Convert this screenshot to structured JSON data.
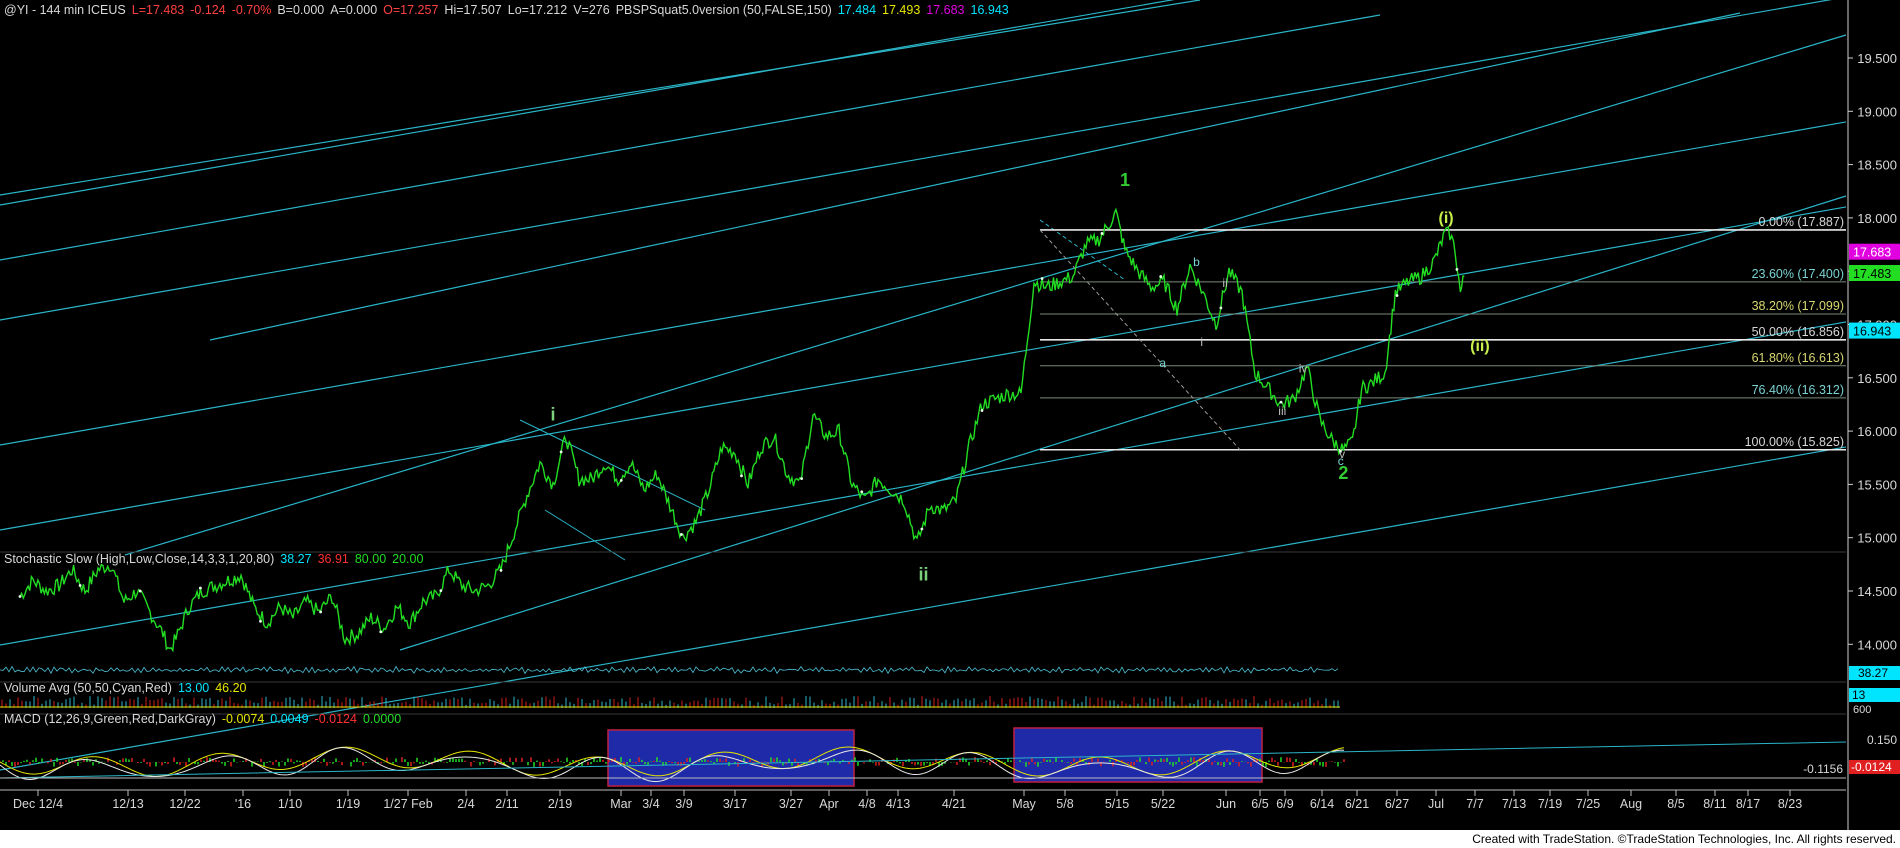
{
  "header": {
    "symbol": "@YI - 144 min  ICEUS",
    "last": "L=17.483",
    "chg": "-0.124",
    "pct": "-0.70%",
    "bid": "B=0.000",
    "ask": "A=0.000",
    "open": "O=17.257",
    "hi": "Hi=17.507",
    "lo": "Lo=17.212",
    "vol": "V=276",
    "study": "PBSPSquat5.0version (50,FALSE,150)",
    "v1": "17.484",
    "v2": "17.493",
    "v3": "17.683",
    "v4": "16.943"
  },
  "colors": {
    "price": "#22dd22",
    "channel": "#2ab5c8",
    "cyan": "#00e5ff",
    "yellow": "#e6e600",
    "magenta": "#e000e0",
    "blue": "#1e2aa8"
  },
  "chart_data": {
    "type": "line",
    "title": "@YI - 144 min ICEUS",
    "ylim": [
      13.75,
      20.0
    ],
    "yticks": [
      14.0,
      14.5,
      15.0,
      15.5,
      16.0,
      16.5,
      17.0,
      17.5,
      18.0,
      18.5,
      19.0,
      19.5
    ],
    "ytick_labels": [
      "14.000",
      "14.500",
      "15.000",
      "15.500",
      "16.000",
      "16.500",
      "17.000",
      "17.500",
      "18.000",
      "18.500",
      "19.000",
      "19.500"
    ],
    "xtick_labels": [
      "Dec 12/4",
      "12/13",
      "12/22",
      "'16",
      "1/10",
      "1/19",
      "1/27 Feb",
      "2/4",
      "2/11",
      "2/19",
      "Mar",
      "3/4",
      "3/9",
      "3/17",
      "3/27",
      "Apr",
      "4/8",
      "4/13",
      "4/21",
      "May",
      "5/8",
      "5/15",
      "5/22",
      "Jun",
      "6/5",
      "6/9",
      "6/14",
      "6/21",
      "6/27",
      "Jul",
      "7/7",
      "7/13",
      "7/19",
      "7/25",
      "Aug",
      "8/5",
      "8/11",
      "8/17",
      "8/23"
    ],
    "price_path": [
      [
        0,
        14.45
      ],
      [
        10,
        14.6
      ],
      [
        20,
        14.5
      ],
      [
        30,
        14.55
      ],
      [
        40,
        14.7
      ],
      [
        50,
        14.5
      ],
      [
        60,
        14.7
      ],
      [
        70,
        14.75
      ],
      [
        80,
        14.4
      ],
      [
        90,
        14.5
      ],
      [
        100,
        14.3
      ],
      [
        110,
        14.1
      ],
      [
        115,
        13.95
      ],
      [
        120,
        14.05
      ],
      [
        130,
        14.35
      ],
      [
        140,
        14.5
      ],
      [
        150,
        14.55
      ],
      [
        160,
        14.6
      ],
      [
        170,
        14.65
      ],
      [
        180,
        14.35
      ],
      [
        190,
        14.2
      ],
      [
        200,
        14.35
      ],
      [
        210,
        14.25
      ],
      [
        220,
        14.4
      ],
      [
        230,
        14.3
      ],
      [
        240,
        14.45
      ],
      [
        250,
        14.05
      ],
      [
        260,
        14.1
      ],
      [
        270,
        14.25
      ],
      [
        280,
        14.15
      ],
      [
        290,
        14.35
      ],
      [
        300,
        14.2
      ],
      [
        310,
        14.4
      ],
      [
        320,
        14.45
      ],
      [
        330,
        14.7
      ],
      [
        340,
        14.55
      ],
      [
        350,
        14.5
      ],
      [
        360,
        14.55
      ],
      [
        370,
        14.7
      ],
      [
        380,
        15.05
      ],
      [
        390,
        15.4
      ],
      [
        400,
        15.7
      ],
      [
        410,
        15.5
      ],
      [
        420,
        15.95
      ],
      [
        430,
        15.55
      ],
      [
        440,
        15.55
      ],
      [
        450,
        15.7
      ],
      [
        460,
        15.55
      ],
      [
        470,
        15.7
      ],
      [
        480,
        15.45
      ],
      [
        490,
        15.6
      ],
      [
        500,
        15.3
      ],
      [
        510,
        15.0
      ],
      [
        520,
        15.15
      ],
      [
        530,
        15.45
      ],
      [
        540,
        15.85
      ],
      [
        550,
        15.8
      ],
      [
        560,
        15.5
      ],
      [
        570,
        15.85
      ],
      [
        580,
        15.95
      ],
      [
        590,
        15.6
      ],
      [
        600,
        15.5
      ],
      [
        610,
        16.15
      ],
      [
        620,
        15.95
      ],
      [
        630,
        16.0
      ],
      [
        640,
        15.5
      ],
      [
        650,
        15.35
      ],
      [
        660,
        15.55
      ],
      [
        670,
        15.45
      ],
      [
        680,
        15.35
      ],
      [
        690,
        14.95
      ],
      [
        700,
        15.3
      ],
      [
        710,
        15.25
      ],
      [
        720,
        15.35
      ],
      [
        730,
        15.85
      ],
      [
        740,
        16.25
      ],
      [
        750,
        16.3
      ],
      [
        760,
        16.35
      ],
      [
        770,
        16.35
      ],
      [
        780,
        17.4
      ],
      [
        790,
        17.35
      ],
      [
        800,
        17.4
      ],
      [
        810,
        17.45
      ],
      [
        820,
        17.75
      ],
      [
        830,
        17.8
      ],
      [
        838,
        17.95
      ],
      [
        843,
        18.05
      ],
      [
        850,
        17.7
      ],
      [
        860,
        17.5
      ],
      [
        870,
        17.35
      ],
      [
        880,
        17.4
      ],
      [
        890,
        17.15
      ],
      [
        900,
        17.55
      ],
      [
        910,
        17.3
      ],
      [
        920,
        17.0
      ],
      [
        930,
        17.5
      ],
      [
        940,
        17.3
      ],
      [
        950,
        16.55
      ],
      [
        960,
        16.4
      ],
      [
        970,
        16.25
      ],
      [
        980,
        16.3
      ],
      [
        990,
        16.6
      ],
      [
        1000,
        16.1
      ],
      [
        1010,
        15.9
      ],
      [
        1018,
        15.82
      ],
      [
        1025,
        15.9
      ],
      [
        1032,
        16.4
      ],
      [
        1040,
        16.45
      ],
      [
        1050,
        16.55
      ],
      [
        1058,
        17.3
      ],
      [
        1068,
        17.4
      ],
      [
        1078,
        17.45
      ],
      [
        1088,
        17.6
      ],
      [
        1096,
        17.85
      ],
      [
        1100,
        17.85
      ],
      [
        1104,
        17.7
      ],
      [
        1108,
        17.3
      ],
      [
        1111,
        17.45
      ]
    ],
    "fibonacci": [
      {
        "label": "0.00% (17.887)",
        "value": 17.887
      },
      {
        "label": "23.60% (17.400)",
        "value": 17.4
      },
      {
        "label": "38.20% (17.099)",
        "value": 17.099
      },
      {
        "label": "50.00% (16.856)",
        "value": 16.856
      },
      {
        "label": "61.80% (16.613)",
        "value": 16.613
      },
      {
        "label": "76.40% (16.312)",
        "value": 16.312
      },
      {
        "label": "100.00% (15.825)",
        "value": 15.825
      }
    ],
    "wave_labels": [
      {
        "text": "1",
        "x": 850,
        "y": 18.3
      },
      {
        "text": "2",
        "x": 1018,
        "y": 15.55
      },
      {
        "text": "i",
        "x": 410,
        "y": 16.1
      },
      {
        "text": "ii",
        "x": 695,
        "y": 14.6
      },
      {
        "text": "(i)",
        "x": 1097,
        "y": 17.95
      },
      {
        "text": "(ii)",
        "x": 1123,
        "y": 16.75
      },
      {
        "text": "a",
        "x": 879,
        "y": 16.6
      },
      {
        "text": "b",
        "x": 905,
        "y": 17.55
      },
      {
        "text": "c",
        "x": 1016,
        "y": 15.68
      },
      {
        "text": "i",
        "x": 909,
        "y": 16.8
      },
      {
        "text": "ii",
        "x": 927,
        "y": 17.35
      },
      {
        "text": "iii",
        "x": 971,
        "y": 16.15
      },
      {
        "text": "iv",
        "x": 987,
        "y": 16.55
      },
      {
        "text": "v",
        "x": 1017,
        "y": 15.75
      }
    ],
    "axis_boxes": [
      {
        "text": "17.683",
        "value": 17.683,
        "bg": "#e000e0",
        "fg": "#ffffff"
      },
      {
        "text": "17.483",
        "value": 17.483,
        "bg": "#22dd22",
        "fg": "#000000"
      },
      {
        "text": "16.943",
        "value": 16.943,
        "bg": "#00e5ff",
        "fg": "#000000"
      }
    ]
  },
  "indicators": {
    "stoch": {
      "label": "Stochastic Slow (High,Low,Close,14,3,3,1,20,80)",
      "v1": "38.27",
      "v2": "36.91",
      "v3": "80.00",
      "v4": "20.00",
      "box": "38.27"
    },
    "volume": {
      "label": "Volume Avg (50,50,Cyan,Red)",
      "v1": "13.00",
      "v2": "46.20",
      "box": "13",
      "tick": "600"
    },
    "macd": {
      "label": "MACD (12,26,9,Green,Red,DarkGray)",
      "v1": "-0.0074",
      "v2": "0.0049",
      "v3": "-0.0124",
      "v4": "0.0000",
      "tick_top": "0.150",
      "tick_mid": "-0.1156",
      "box": "-0.0124"
    }
  },
  "footer": "Created with TradeStation. ©TradeStation Technologies, Inc. All rights reserved."
}
